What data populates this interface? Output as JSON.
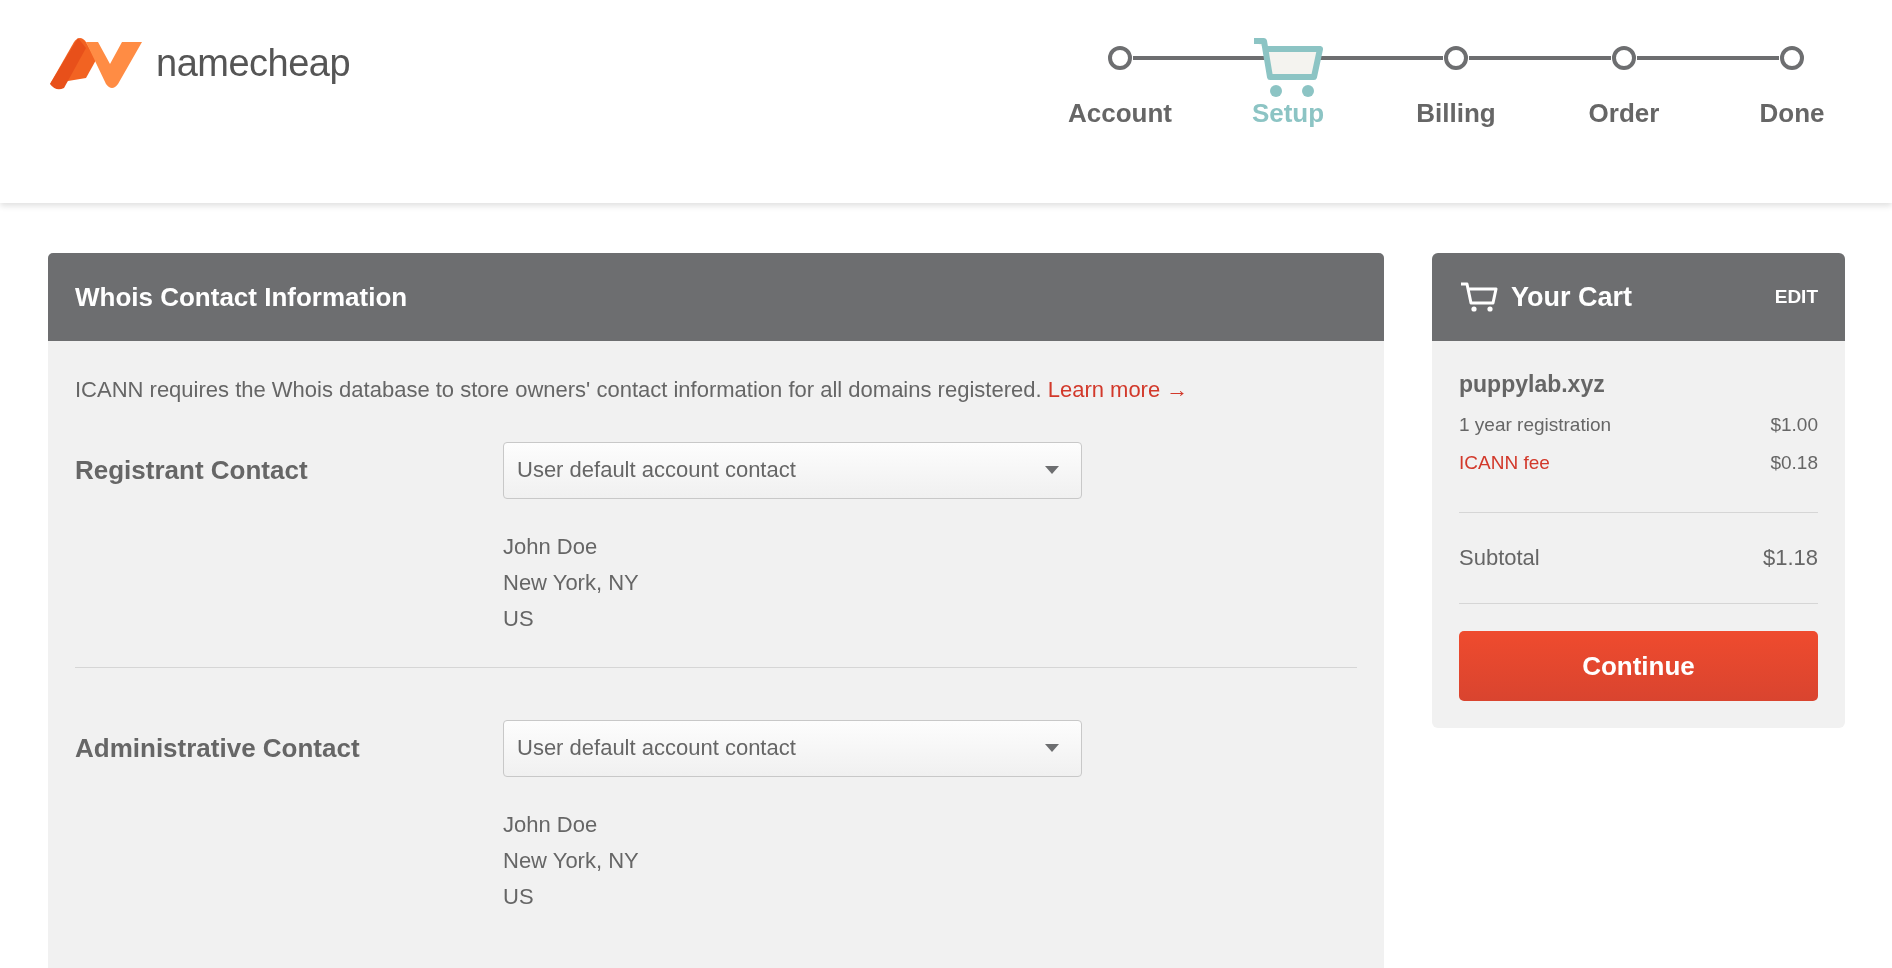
{
  "logo": {
    "text": "namecheap"
  },
  "steps": [
    {
      "label": "Account",
      "selected": false
    },
    {
      "label": "Setup",
      "selected": true
    },
    {
      "label": "Billing",
      "selected": false
    },
    {
      "label": "Order",
      "selected": false
    },
    {
      "label": "Done",
      "selected": false
    }
  ],
  "whois": {
    "title": "Whois Contact Information",
    "description": "ICANN requires the Whois database to store owners' contact information for all domains registered.",
    "learn_more": "Learn more →",
    "contacts": [
      {
        "label": "Registrant Contact",
        "value": "User default account contact",
        "lines": [
          "John Doe",
          "New York, NY",
          "US"
        ]
      },
      {
        "label": "Administrative Contact",
        "value": "User default account contact",
        "lines": [
          "John Doe",
          "New York, NY",
          "US"
        ]
      }
    ]
  },
  "cart": {
    "title": "Your Cart",
    "edit": "EDIT",
    "domain": "puppylab.xyz",
    "items": [
      {
        "kind": "text",
        "label": "1 year registration",
        "price": "$1.00"
      },
      {
        "kind": "link",
        "label": "ICANN fee",
        "price": "$0.18"
      }
    ],
    "subtotal_label": "Subtotal",
    "subtotal": "$1.18",
    "button": "Continue"
  }
}
